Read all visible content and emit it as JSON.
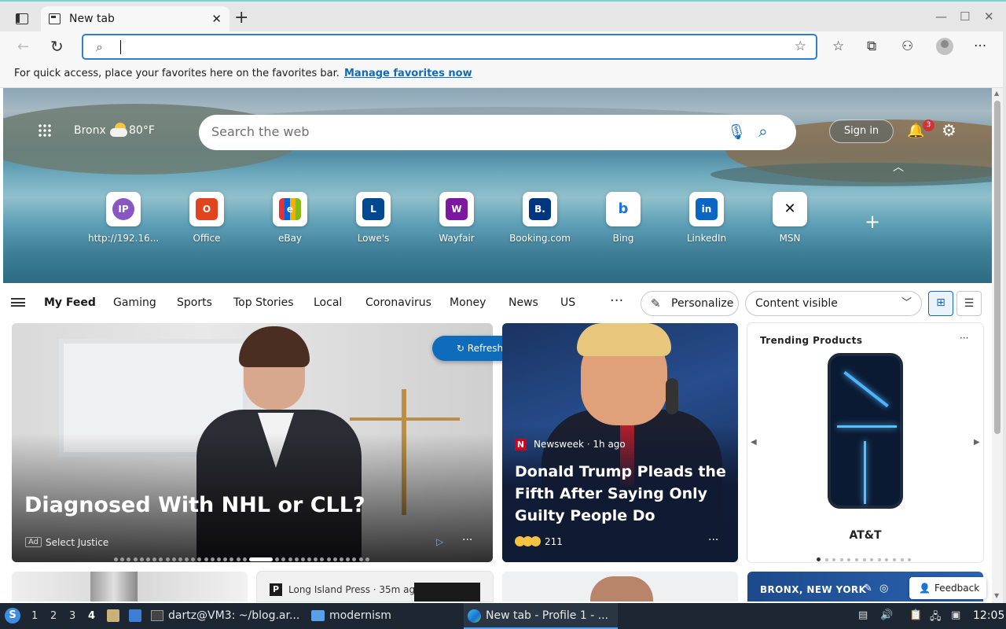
{
  "browser": {
    "tab_title": "New tab",
    "tab_close": "✕",
    "new_tab": "+",
    "window_controls": {
      "minimize": "—",
      "maximize": "☐",
      "close": "✕"
    },
    "address_value": "",
    "favorites_bar": {
      "message": "For quick access, place your favorites here on the favorites bar.",
      "link": "Manage favorites now"
    }
  },
  "hero": {
    "location": "Bronx",
    "temperature": "80°F",
    "search_placeholder": "Search the web",
    "sign_in": "Sign in",
    "notification_count": "3",
    "quick_links": [
      {
        "label": "http://192.16...",
        "glyph": "IP",
        "color": "#8a56c2"
      },
      {
        "label": "Office",
        "glyph": "O",
        "color": "#e0451f"
      },
      {
        "label": "eBay",
        "glyph": "e",
        "color": "#3766c2"
      },
      {
        "label": "Lowe's",
        "glyph": "L",
        "color": "#004990"
      },
      {
        "label": "Wayfair",
        "glyph": "W",
        "color": "#7b189f"
      },
      {
        "label": "Booking.com",
        "glyph": "B.",
        "color": "#003580"
      },
      {
        "label": "Bing",
        "glyph": "b",
        "color": "#1a73e8"
      },
      {
        "label": "LinkedIn",
        "glyph": "in",
        "color": "#0a66c2"
      },
      {
        "label": "MSN",
        "glyph": "✕",
        "color": "#111111"
      }
    ]
  },
  "feed_nav": {
    "items": [
      "My Feed",
      "Gaming",
      "Sports",
      "Top Stories",
      "Local",
      "Coronavirus",
      "Money",
      "News",
      "US"
    ],
    "more": "···",
    "personalize": "Personalize",
    "content_visibility": "Content visible"
  },
  "refresh_button": "Refresh stories",
  "cards": {
    "ad": {
      "title": "Diagnosed With NHL or CLL?",
      "ad_badge": "Ad",
      "source": "Select Justice",
      "play": "▷",
      "more": "···"
    },
    "news": {
      "source": "Newsweek · 1h ago",
      "source_logo": "N",
      "title": "Donald Trump Pleads the Fifth After Saying Only Guilty People Do",
      "reaction_count": "211",
      "more": "···"
    },
    "trending": {
      "title": "Trending Products",
      "more": "···",
      "brand": "AT&T"
    }
  },
  "bottom_row": {
    "press_source": "Long Island Press · 35m ag",
    "press_logo": "P",
    "weather_location": "BRONX, NEW YORK",
    "feedback": "Feedback"
  },
  "taskbar": {
    "workspaces": [
      "1",
      "2",
      "3",
      "4"
    ],
    "active_workspace": "4",
    "terminal_task": "dartz@VM3: ~/blog.ar...",
    "folder_task": "modernism",
    "browser_task": "New tab - Profile 1 - ...",
    "clock": "12:05"
  }
}
